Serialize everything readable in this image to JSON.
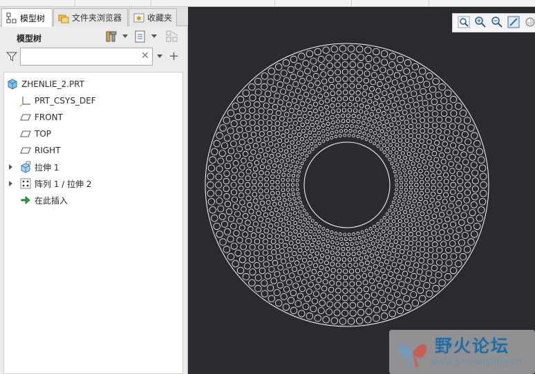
{
  "tabs": [
    {
      "label": "模型树",
      "icon": "model-tree-icon",
      "active": true
    },
    {
      "label": "文件夹浏览器",
      "icon": "folder-browser-icon",
      "active": false
    },
    {
      "label": "收藏夹",
      "icon": "favorites-icon",
      "active": false
    }
  ],
  "tree_toolbar": {
    "title": "模型树",
    "buttons": [
      "settings-tools-icon",
      "show-options-icon",
      "columns-icon"
    ]
  },
  "filter": {
    "value": "",
    "placeholder": ""
  },
  "tree": {
    "root": {
      "label": "ZHENLIE_2.PRT",
      "icon": "part-icon"
    },
    "items": [
      {
        "label": "PRT_CSYS_DEF",
        "icon": "csys-icon",
        "expandable": false
      },
      {
        "label": "FRONT",
        "icon": "datum-plane-icon",
        "expandable": false
      },
      {
        "label": "TOP",
        "icon": "datum-plane-icon",
        "expandable": false
      },
      {
        "label": "RIGHT",
        "icon": "datum-plane-icon",
        "expandable": false
      },
      {
        "label": "拉伸 1",
        "icon": "extrude-icon",
        "expandable": true
      },
      {
        "label": "阵列 1 / 拉伸 2",
        "icon": "pattern-icon",
        "expandable": true
      },
      {
        "label": "在此插入",
        "icon": "insert-here-arrow-icon",
        "expandable": false
      }
    ]
  },
  "view_toolbar": [
    "refit-icon",
    "zoom-in-icon",
    "zoom-out-icon",
    "repaint-icon",
    "display-style-icon"
  ],
  "watermark": {
    "title": "野火论坛",
    "url": "www.proewildfire.cn"
  },
  "colors": {
    "viewport_bg": "#2b2b2f",
    "geometry": "#ffffff",
    "accent": "#1c6fa8"
  }
}
